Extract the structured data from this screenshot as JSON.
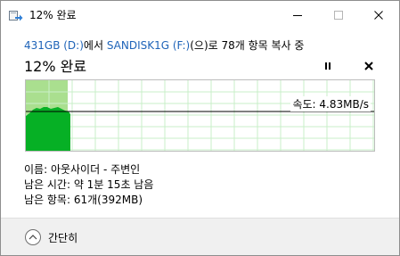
{
  "window": {
    "title": "12% 완료",
    "icons": {
      "app": "copy-arrow-icon",
      "minimize": "minimize-icon",
      "maximize": "maximize-icon",
      "close": "close-icon"
    }
  },
  "header": {
    "source": "431GB (D:)",
    "from_text": "에서 ",
    "destination": "SANDISK1G (F:)",
    "action_text": "(으)로 78개 항목 복사 중",
    "progress_title": "12% 완료"
  },
  "controls": {
    "pause_icon": "pause-icon",
    "cancel_icon": "cancel-x-icon"
  },
  "progress": {
    "fraction": 0.12
  },
  "speed": {
    "text": "속도: 4.83MB/s"
  },
  "details": {
    "name": "이름: 아웃사이더 - 주변인",
    "time_left": "남은 시간: 약 1분 15초 남음",
    "items_left": "남은 항목: 61개(392MB)"
  },
  "footer": {
    "collapse_label": "간단히",
    "collapse_icon": "chevron-up-icon"
  },
  "colors": {
    "accent_link": "#1e63b8",
    "progress_fill": "#aadf8f",
    "throughput": "#06b025",
    "grid": "#c9efc9"
  }
}
